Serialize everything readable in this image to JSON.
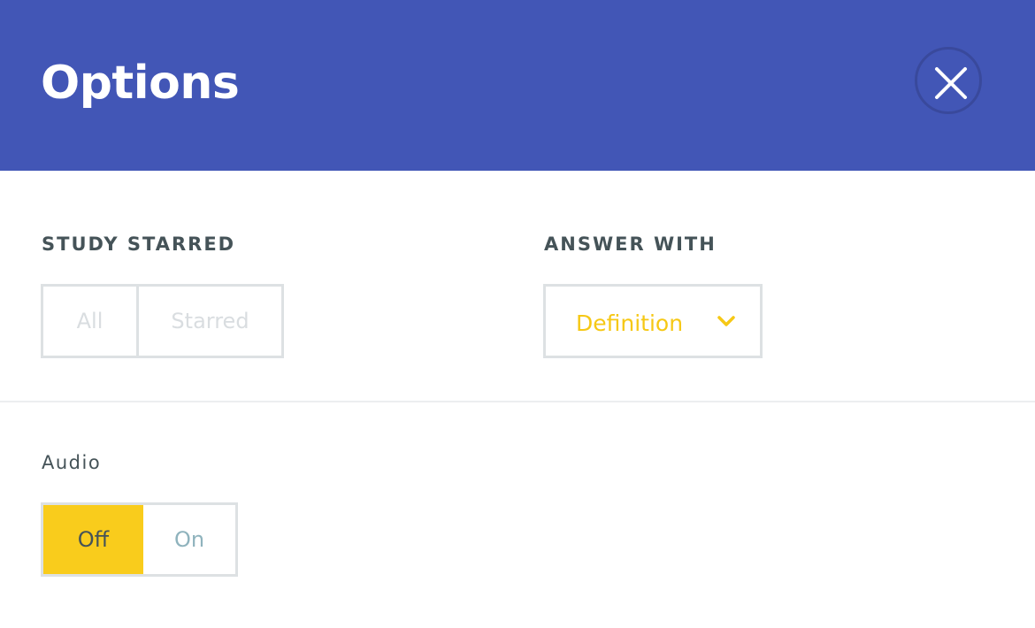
{
  "colors": {
    "header_bg": "#4256b6",
    "accent_yellow": "#f6c815",
    "border_gray": "#dde1e3",
    "label_text": "#455358",
    "on_text": "#8fb3bd"
  },
  "header": {
    "title": "Options",
    "close_icon": "close-icon"
  },
  "study_starred": {
    "label": "STUDY STARRED",
    "options": [
      "All",
      "Starred"
    ],
    "selected": null
  },
  "answer_with": {
    "label": "ANSWER WITH",
    "value": "Definition",
    "icon": "chevron-down-icon"
  },
  "audio": {
    "label": "Audio",
    "options": [
      "Off",
      "On"
    ],
    "selected": "Off"
  }
}
